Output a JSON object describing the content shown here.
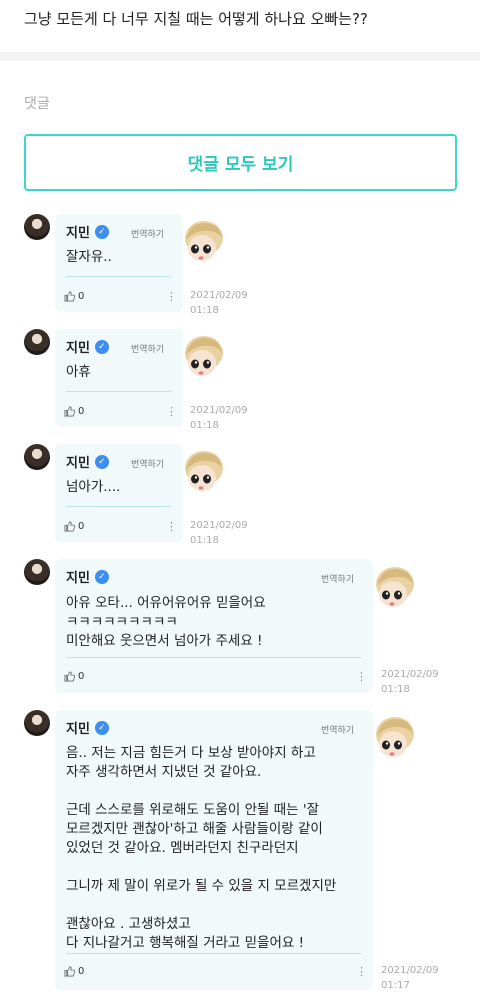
{
  "post": {
    "text": "그냥 모든게 다 너무 지칠 때는 어떻게 하나요 오빠는??"
  },
  "comments_section": {
    "label": "댓글",
    "view_all_label": "댓글 모두 보기"
  },
  "comments": [
    {
      "author": "지민",
      "verified": true,
      "translate_label": "번역하기",
      "text": "잘자유..",
      "likes": "0",
      "date": "2021/02/09",
      "time": "01:18"
    },
    {
      "author": "지민",
      "verified": true,
      "translate_label": "번역하기",
      "text": "아휴",
      "likes": "0",
      "date": "2021/02/09",
      "time": "01:18"
    },
    {
      "author": "지민",
      "verified": true,
      "translate_label": "번역하기",
      "text": "넘아가....",
      "likes": "0",
      "date": "2021/02/09",
      "time": "01:18"
    },
    {
      "author": "지민",
      "verified": true,
      "translate_label": "번역하기",
      "text": "아유 오타... 어유어유어유 믿을어요\nㅋㅋㅋㅋㅋㅋㅋㅋㅋ\n미안해요 웃으면서 넘아가 주세요 !",
      "likes": "0",
      "date": "2021/02/09",
      "time": "01:18"
    },
    {
      "author": "지민",
      "verified": true,
      "translate_label": "번역하기",
      "text": "음.. 저는 지금 힘든거 다 보상 받아야지 하고\n자주 생각하면서 지냈던 것 같아요.\n\n근데 스스로를 위로해도 도움이 안될 때는 '잘\n모르겠지만 괜찮아'하고 해줄 사람들이랑 같이\n있었던 것 같아요. 멤버라던지 친구라던지\n\n그니까 제 말이 위로가 될 수 있을 지 모르겠지만\n\n괜찮아요 . 고생하셨고\n다 지나갈거고 행복해질 거라고 믿을어요 !",
      "likes": "0",
      "date": "2021/02/09",
      "time": "01:17"
    }
  ],
  "colors": {
    "accent": "#2cc9bb",
    "bubble": "#f1f9fb",
    "verified": "#3b8ff0"
  },
  "icons": {
    "like": "thumbs-up-icon",
    "more": "more-vertical-icon",
    "verified": "verified-check-icon"
  }
}
